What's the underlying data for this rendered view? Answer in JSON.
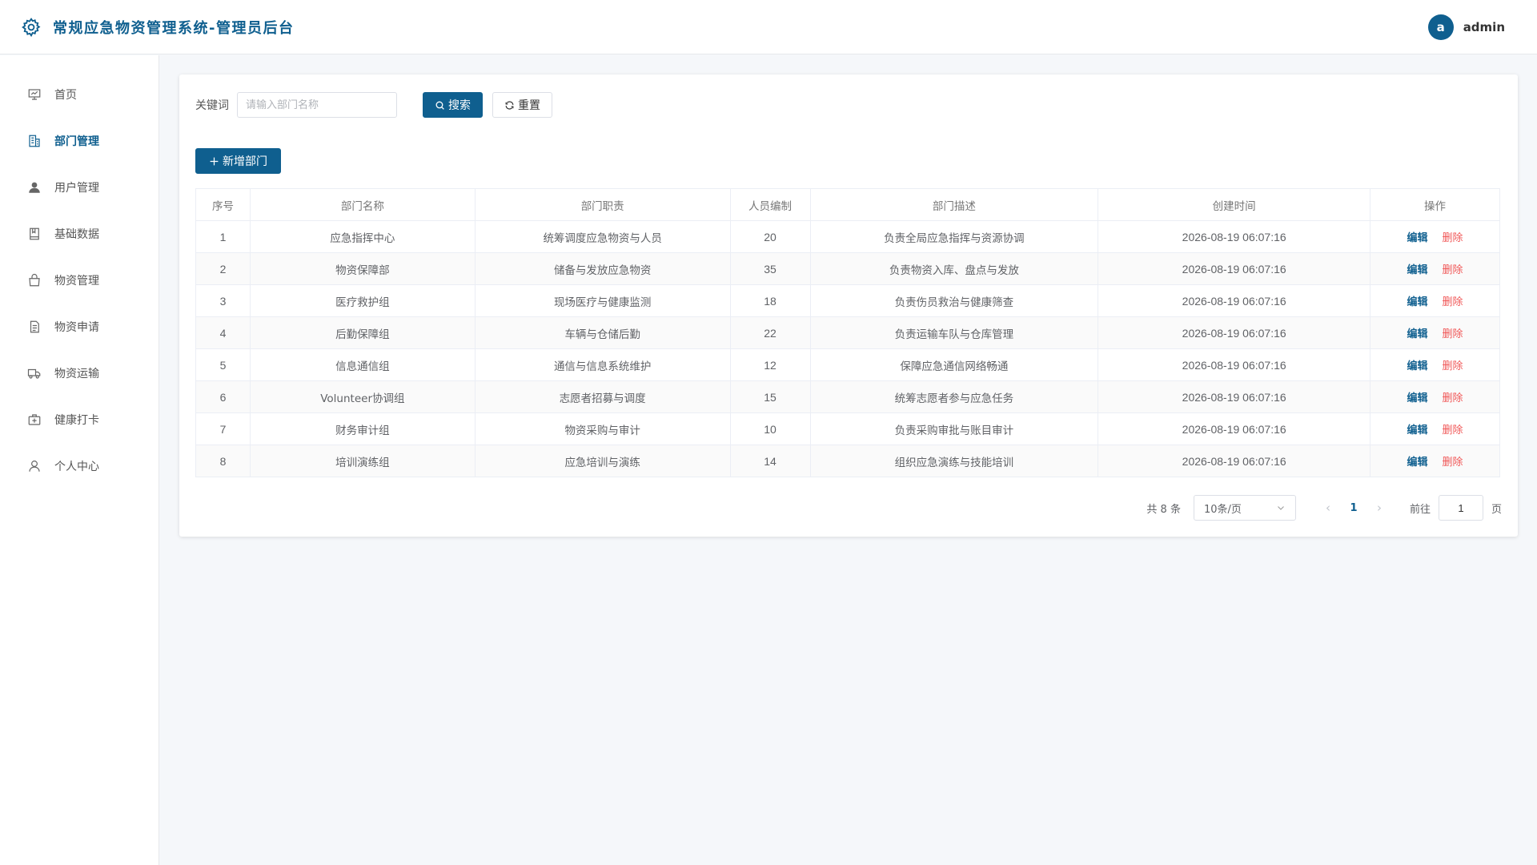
{
  "header": {
    "title": "常规应急物资管理系统-管理员后台",
    "avatar_letter": "a",
    "user_name": "admin"
  },
  "sidebar": {
    "items": [
      {
        "label": "首页",
        "icon": "presentation-icon",
        "active": false
      },
      {
        "label": "部门管理",
        "icon": "building-icon",
        "active": true
      },
      {
        "label": "用户管理",
        "icon": "user-icon",
        "active": false
      },
      {
        "label": "基础数据",
        "icon": "book-icon",
        "active": false
      },
      {
        "label": "物资管理",
        "icon": "bag-icon",
        "active": false
      },
      {
        "label": "物资申请",
        "icon": "document-icon",
        "active": false
      },
      {
        "label": "物资运输",
        "icon": "truck-icon",
        "active": false
      },
      {
        "label": "健康打卡",
        "icon": "medkit-icon",
        "active": false
      },
      {
        "label": "个人中心",
        "icon": "person-icon",
        "active": false
      }
    ]
  },
  "search": {
    "label": "关键词",
    "placeholder": "请输入部门名称",
    "value": "",
    "search_label": "搜索",
    "reset_label": "重置"
  },
  "add_label": "新增部门",
  "table": {
    "headers": [
      "序号",
      "部门名称",
      "部门职责",
      "人员编制",
      "部门描述",
      "创建时间",
      "操作"
    ],
    "edit_label": "编辑",
    "delete_label": "删除",
    "rows": [
      [
        "1",
        "应急指挥中心",
        "统筹调度应急物资与人员",
        "20",
        "负责全局应急指挥与资源协调",
        "2026-08-19 06:07:16"
      ],
      [
        "2",
        "物资保障部",
        "储备与发放应急物资",
        "35",
        "负责物资入库、盘点与发放",
        "2026-08-19 06:07:16"
      ],
      [
        "3",
        "医疗救护组",
        "现场医疗与健康监测",
        "18",
        "负责伤员救治与健康筛查",
        "2026-08-19 06:07:16"
      ],
      [
        "4",
        "后勤保障组",
        "车辆与仓储后勤",
        "22",
        "负责运输车队与仓库管理",
        "2026-08-19 06:07:16"
      ],
      [
        "5",
        "信息通信组",
        "通信与信息系统维护",
        "12",
        "保障应急通信网络畅通",
        "2026-08-19 06:07:16"
      ],
      [
        "6",
        "Volunteer协调组",
        "志愿者招募与调度",
        "15",
        "统筹志愿者参与应急任务",
        "2026-08-19 06:07:16"
      ],
      [
        "7",
        "财务审计组",
        "物资采购与审计",
        "10",
        "负责采购审批与账目审计",
        "2026-08-19 06:07:16"
      ],
      [
        "8",
        "培训演练组",
        "应急培训与演练",
        "14",
        "组织应急演练与技能培训",
        "2026-08-19 06:07:16"
      ]
    ]
  },
  "pagination": {
    "total": "共 8 条",
    "page_size": "10条/页",
    "current": "1",
    "goto_label": "前往",
    "goto_value": "1",
    "unit": "页"
  },
  "colors": {
    "primary": "#0f5f8f",
    "danger": "#f05656"
  }
}
